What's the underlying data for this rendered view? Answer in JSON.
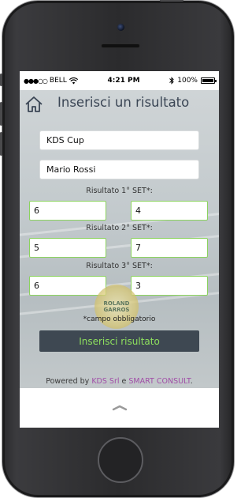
{
  "status_bar": {
    "carrier": "BELL",
    "time": "4:21 PM",
    "battery": "100%",
    "signal_dots": "●●●○○"
  },
  "header": {
    "title": "Inserisci un risultato"
  },
  "form": {
    "tournament_value": "KDS Cup",
    "player_value": "Mario Rossi",
    "sets": [
      {
        "label": "Risultato 1° SET*:",
        "score_a": "6",
        "score_b": "4"
      },
      {
        "label": "Risultato 2° SET*:",
        "score_a": "5",
        "score_b": "7"
      },
      {
        "label": "Risultato 3° SET*:",
        "score_a": "6",
        "score_b": "3"
      }
    ],
    "required_note": "*campo obbligatorio",
    "submit_label": "Inserisci risultato"
  },
  "logo_text": "ROLAND GARROS",
  "footer": {
    "prefix": "Powered by ",
    "brand1": "KDS Srl",
    "middle": " e ",
    "brand2": "SMART CONSULT",
    "suffix": "."
  },
  "colors": {
    "accent_green": "#8ee05e",
    "button_dark": "#3e4852",
    "footer_brand": "#a14ea7"
  }
}
